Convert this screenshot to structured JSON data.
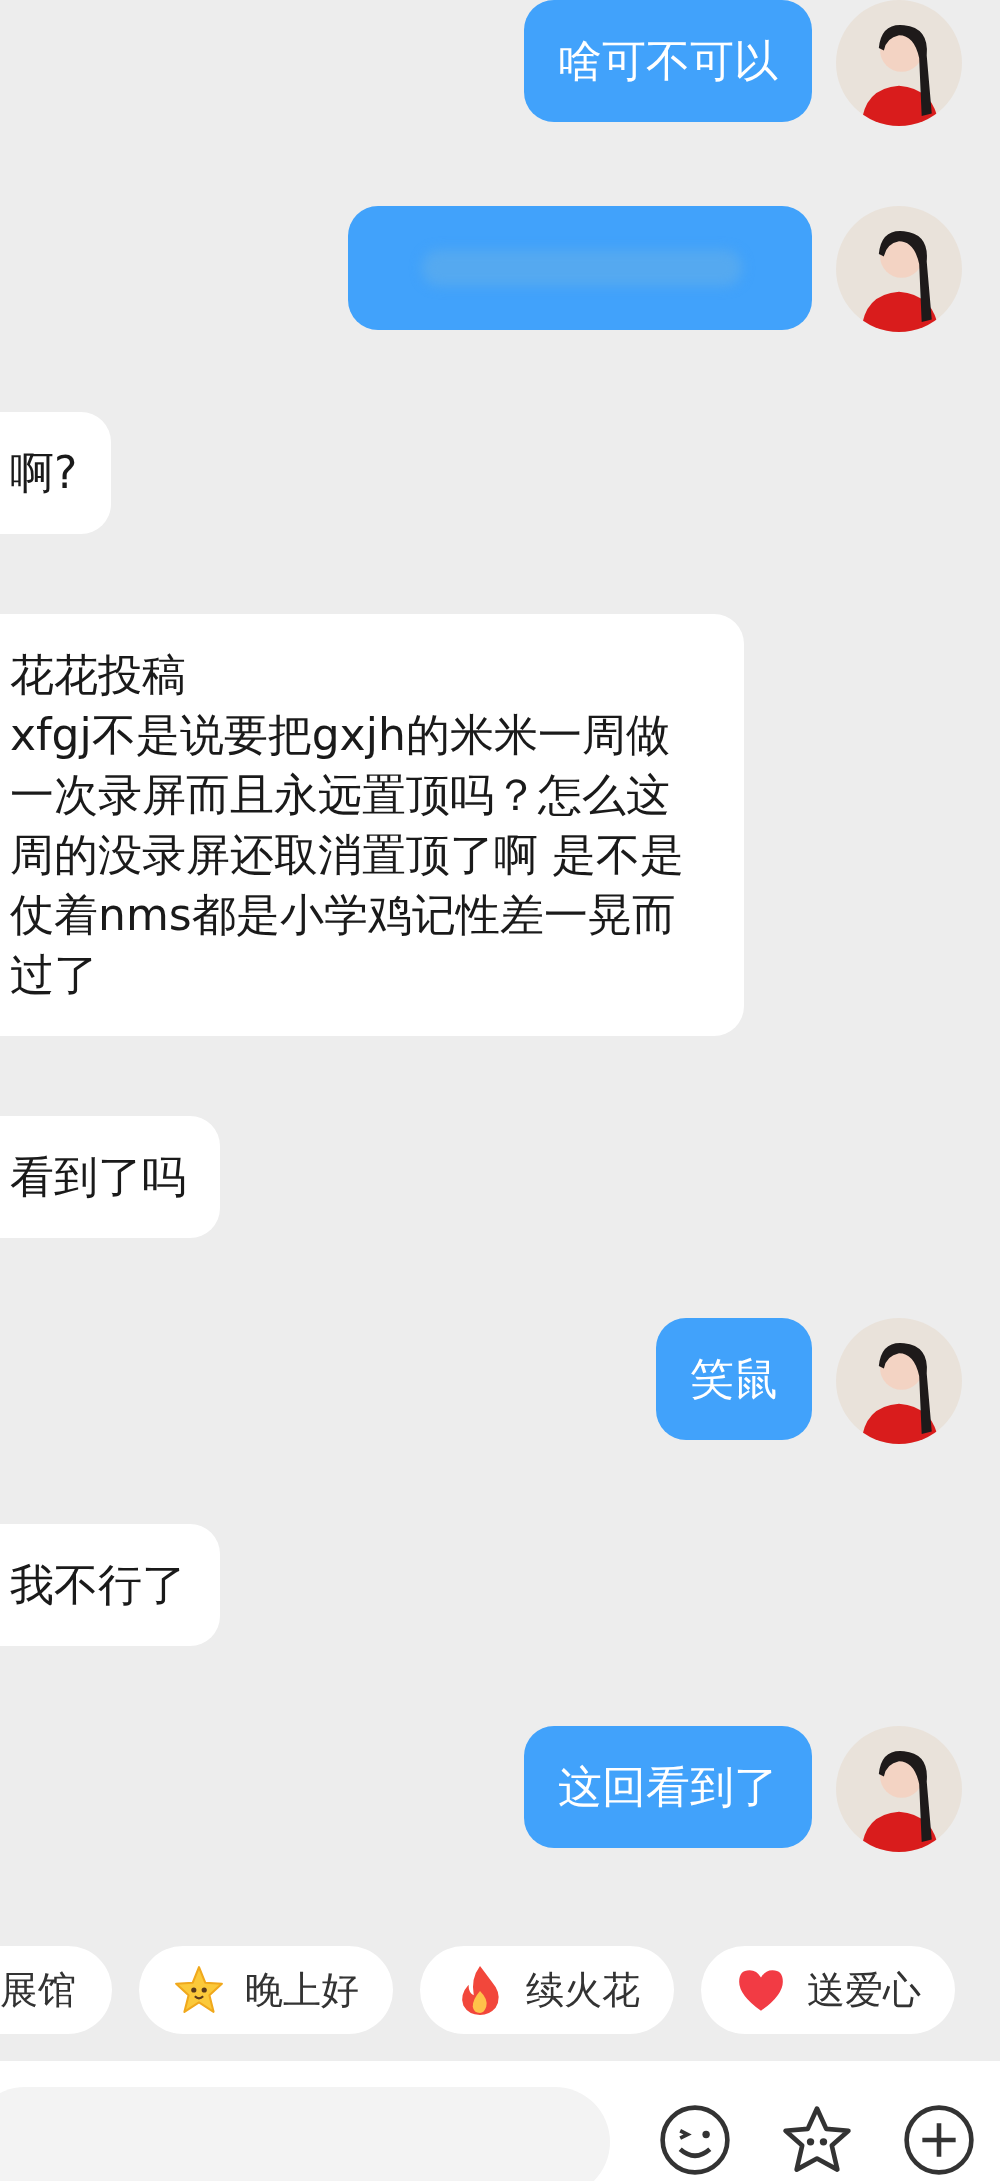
{
  "messages": [
    {
      "kind": "sent",
      "text": "啥可不可以"
    },
    {
      "kind": "sent_blurred"
    },
    {
      "kind": "received",
      "text": "啊?"
    },
    {
      "kind": "received",
      "text": "花花投稿\nxfgj不是说要把gxjh的米米一周做一次录屏而且永远置顶吗？怎么这周的没录屏还取消置顶了啊 是不是仗着nms都是小学鸡记性差一晃而过了"
    },
    {
      "kind": "received",
      "text": "看到了吗"
    },
    {
      "kind": "sent",
      "text": "笑鼠"
    },
    {
      "kind": "received",
      "text": "我不行了"
    },
    {
      "kind": "sent",
      "text": "这回看到了"
    }
  ],
  "quick_replies": [
    {
      "kind": "plain",
      "label": "展馆"
    },
    {
      "kind": "star",
      "label": "晚上好"
    },
    {
      "kind": "fire",
      "label": "续火花"
    },
    {
      "kind": "heart",
      "label": "送爱心"
    }
  ]
}
